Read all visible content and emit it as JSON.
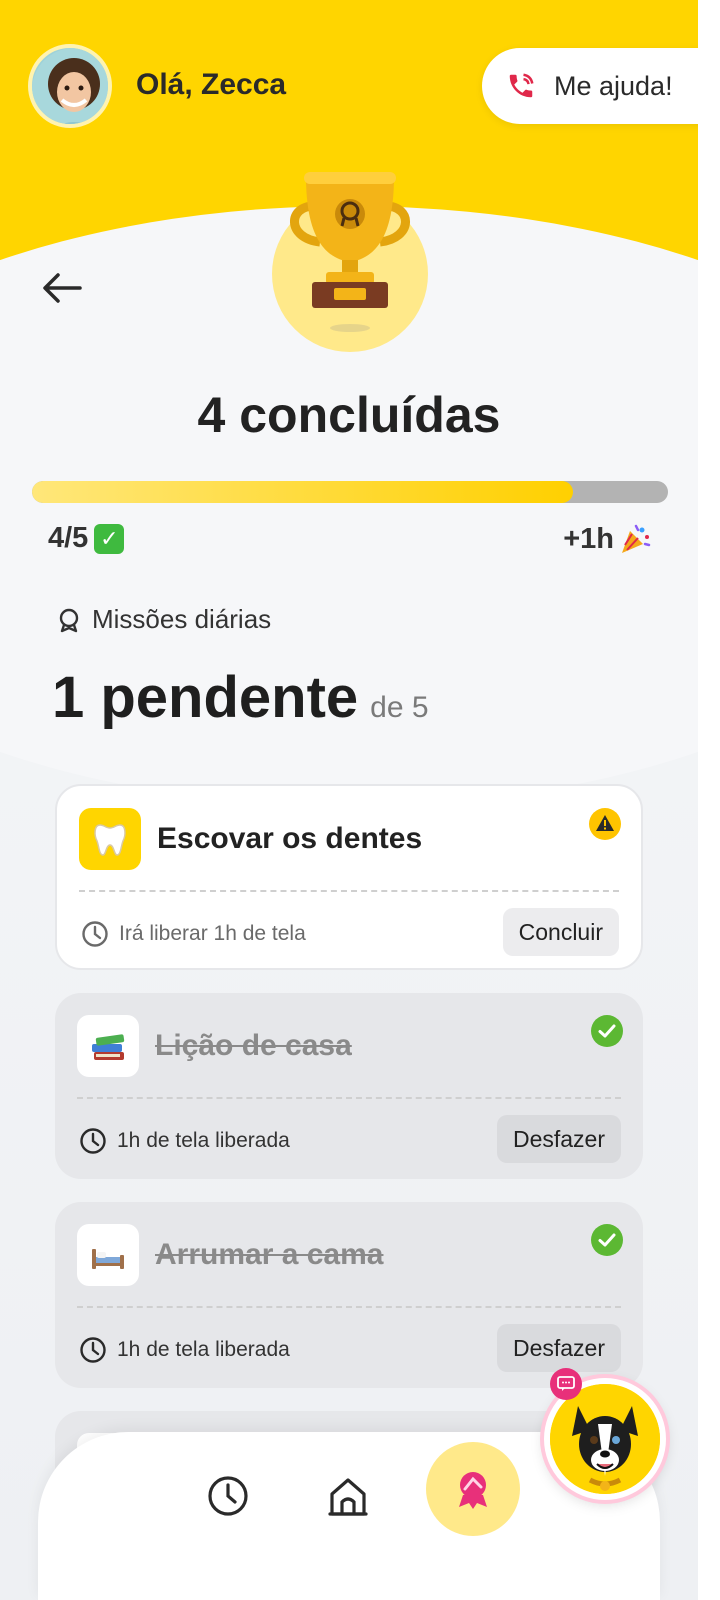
{
  "header": {
    "greeting": "Olá, Zecca",
    "help_label": "Me ajuda!"
  },
  "summary": {
    "title": "4 concluídas",
    "progress_fraction": 0.85,
    "count_label": "4/5",
    "count_emoji": "check-mark-button",
    "reward_label": "+1h",
    "reward_emoji": "party-popper"
  },
  "missions": {
    "section_label": "Missões diárias",
    "pending_big": "1 pendente",
    "pending_small": "de 5",
    "items": [
      {
        "name": "Escovar os dentes",
        "icon": "tooth-icon",
        "status": "warning",
        "meta": "Irá liberar 1h de tela",
        "action": "Concluir"
      },
      {
        "name": "Lição de casa",
        "icon": "books-icon",
        "status": "done",
        "meta": "1h de tela liberada",
        "action": "Desfazer"
      },
      {
        "name": "Arrumar a cama",
        "icon": "bed-icon",
        "status": "done",
        "meta": "1h de tela liberada",
        "action": "Desfazer"
      }
    ]
  },
  "nav": {
    "items": [
      "clock-icon",
      "home-icon",
      "missions-badge-icon"
    ],
    "active": "missions-badge-icon"
  },
  "colors": {
    "brand_yellow": "#ffd500",
    "success_green": "#4caf50",
    "accent_pink": "#e8307a"
  }
}
